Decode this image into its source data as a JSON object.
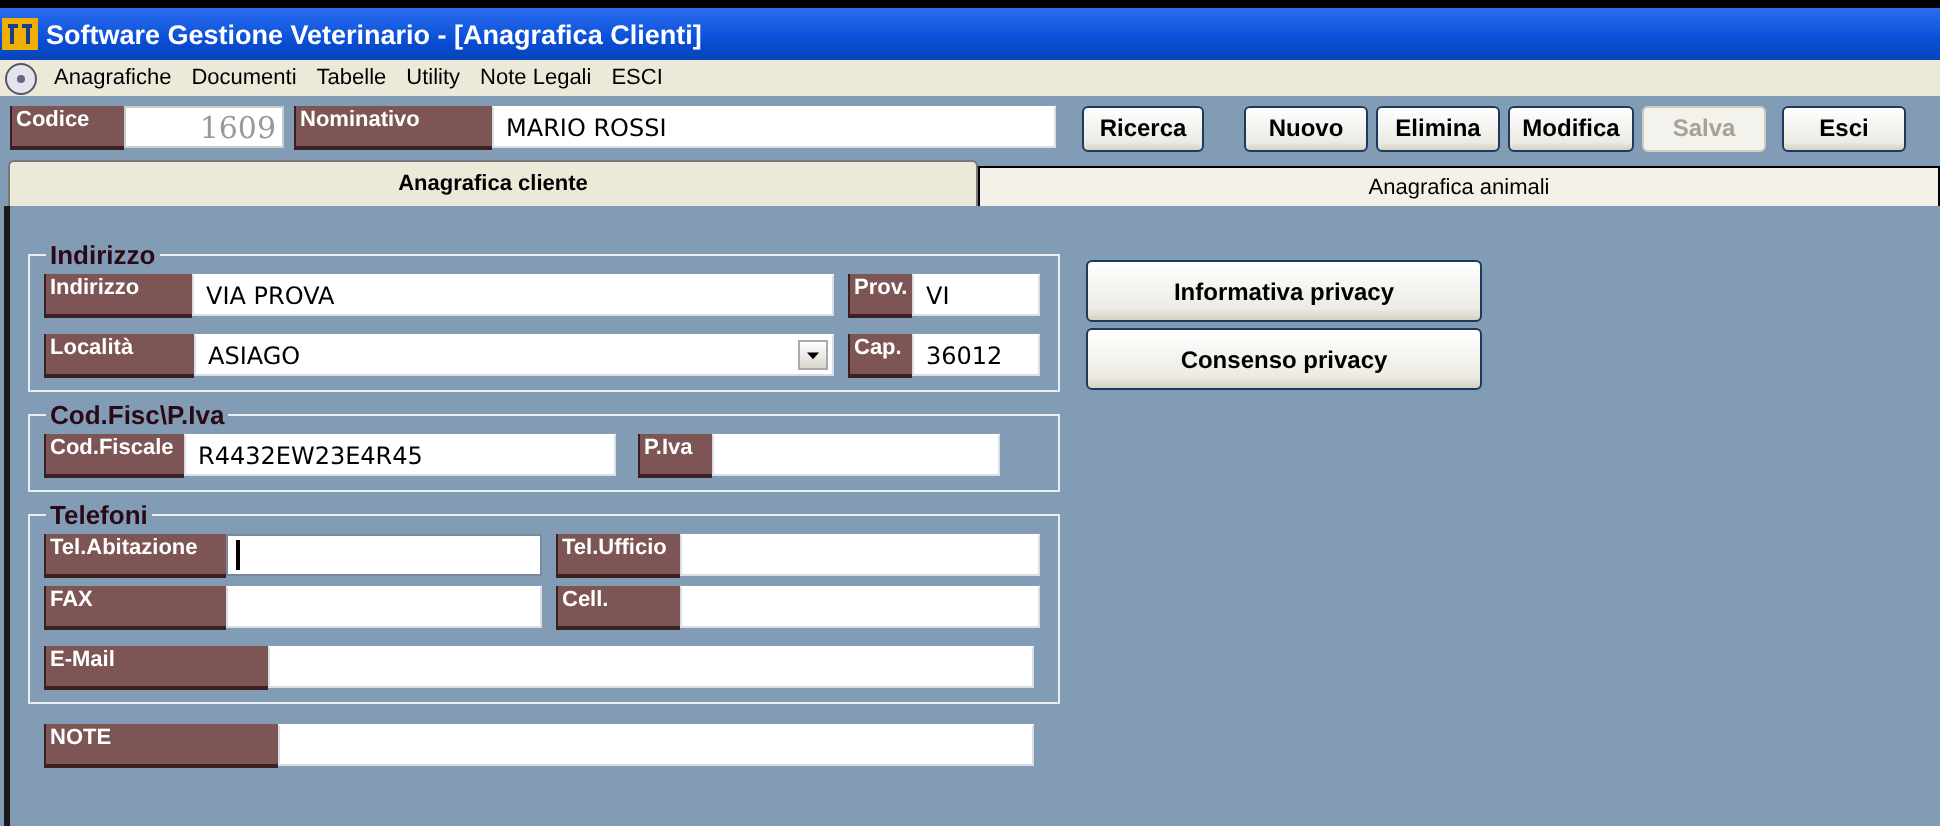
{
  "window": {
    "title": "Software Gestione Veterinario - [Anagrafica Clienti]"
  },
  "menu": [
    "Anagrafiche",
    "Documenti",
    "Tabelle",
    "Utility",
    "Note Legali",
    "ESCI"
  ],
  "header_fields": [
    {
      "label": "Codice",
      "value": "1609",
      "kind": "code"
    },
    {
      "label": "Nominativo",
      "value": "MARIO ROSSI",
      "kind": "text"
    }
  ],
  "toolbar": [
    {
      "label": "Ricerca",
      "disabled": false
    },
    {
      "label": "Nuovo",
      "disabled": false
    },
    {
      "label": "Elimina",
      "disabled": false
    },
    {
      "label": "Modifica",
      "disabled": false
    },
    {
      "label": "Salva",
      "disabled": true
    },
    {
      "label": "Esci",
      "disabled": false
    }
  ],
  "tabs": [
    {
      "label": "Anagrafica cliente",
      "selected": true
    },
    {
      "label": "Anagrafica animali",
      "selected": false
    }
  ],
  "groups": [
    {
      "title": "Indirizzo",
      "rows": [
        [
          {
            "label": "Indirizzo",
            "value": "VIA PROVA",
            "kind": "text",
            "focused": false
          },
          {
            "label": "Prov.",
            "value": "VI",
            "kind": "text",
            "focused": false
          }
        ],
        [
          {
            "label": "Località",
            "value": "ASIAGO",
            "kind": "combo",
            "focused": false
          },
          {
            "label": "Cap.",
            "value": "36012",
            "kind": "text",
            "focused": false
          }
        ]
      ]
    },
    {
      "title": "Cod.Fisc\\P.Iva",
      "rows": [
        [
          {
            "label": "Cod.Fiscale",
            "value": "R4432EW23E4R45",
            "kind": "text",
            "focused": false
          },
          {
            "label": "P.Iva",
            "kind": "text",
            "focused": false
          }
        ]
      ]
    },
    {
      "title": "Telefoni",
      "rows": [
        [
          {
            "label": "Tel.Abitazione",
            "kind": "text",
            "focused": true
          },
          {
            "label": "Tel.Ufficio",
            "kind": "text",
            "focused": false
          }
        ],
        [
          {
            "label": "FAX",
            "kind": "text",
            "focused": false
          },
          {
            "label": "Cell.",
            "kind": "text",
            "focused": false
          }
        ],
        [
          {
            "label": "E-Mail",
            "kind": "text",
            "focused": false
          }
        ]
      ]
    }
  ],
  "note": {
    "label": "NOTE",
    "kind": "text",
    "focused": false
  },
  "privacy_buttons": [
    "Informativa privacy",
    "Consenso privacy"
  ]
}
